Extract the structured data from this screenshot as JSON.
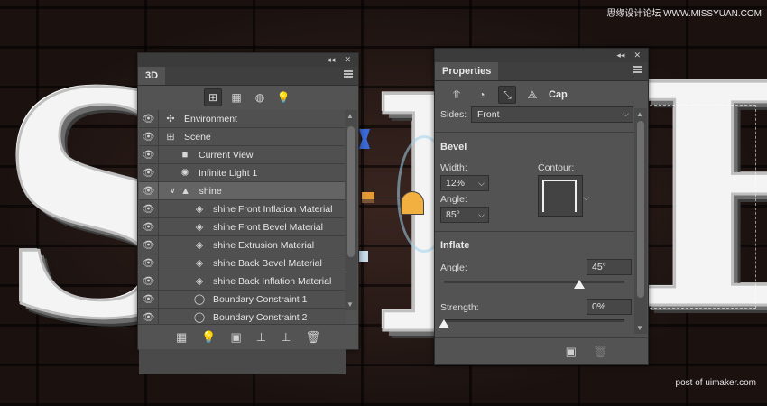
{
  "canvas": {
    "letters": [
      "S",
      "I",
      "E"
    ],
    "watermark_top": "思缘设计论坛 WWW.MISSYUAN.COM",
    "watermark_bottom": "post of uimaker.com"
  },
  "panel3d": {
    "tab": "3D",
    "collapse_glyph": "◂◂",
    "close_glyph": "✕",
    "toolbar": [
      {
        "name": "whole-scene-icon",
        "glyph": "⊞",
        "active": true
      },
      {
        "name": "meshes-icon",
        "glyph": "▦",
        "active": false
      },
      {
        "name": "materials-icon",
        "glyph": "◍",
        "active": false
      },
      {
        "name": "lights-icon",
        "glyph": "💡",
        "active": false
      }
    ],
    "rows": [
      {
        "label": "Environment",
        "icon": "✣",
        "indent": 0,
        "eye": true,
        "twisty": ""
      },
      {
        "label": "Scene",
        "icon": "⊞",
        "indent": 0,
        "eye": true,
        "twisty": ""
      },
      {
        "label": "Current View",
        "icon": "■",
        "indent": 1,
        "eye": true,
        "twisty": ""
      },
      {
        "label": "Infinite Light 1",
        "icon": "✺",
        "indent": 1,
        "eye": true,
        "twisty": ""
      },
      {
        "label": "shine",
        "icon": "▲",
        "indent": 1,
        "eye": true,
        "twisty": "∨",
        "selected": true
      },
      {
        "label": "shine Front Inflation Material",
        "icon": "◈",
        "indent": 2,
        "eye": true,
        "twisty": ""
      },
      {
        "label": "shine Front Bevel Material",
        "icon": "◈",
        "indent": 2,
        "eye": true,
        "twisty": ""
      },
      {
        "label": "shine Extrusion Material",
        "icon": "◈",
        "indent": 2,
        "eye": true,
        "twisty": ""
      },
      {
        "label": "shine Back Bevel Material",
        "icon": "◈",
        "indent": 2,
        "eye": true,
        "twisty": ""
      },
      {
        "label": "shine Back Inflation Material",
        "icon": "◈",
        "indent": 2,
        "eye": true,
        "twisty": ""
      },
      {
        "label": "Boundary Constraint 1",
        "icon": "◯",
        "indent": 2,
        "eye": true,
        "twisty": ""
      },
      {
        "label": "Boundary Constraint 2",
        "icon": "◯",
        "indent": 2,
        "eye": true,
        "twisty": ""
      }
    ],
    "bottom_icons": [
      "▦",
      "💡",
      "▣",
      "⊥",
      "⊥",
      "🗑"
    ]
  },
  "properties": {
    "tab": "Properties",
    "collapse_glyph": "◂◂",
    "close_glyph": "✕",
    "toolbar_label": "Cap",
    "sides_label": "Sides:",
    "sides_value": "Front",
    "bevel_heading": "Bevel",
    "width_label": "Width:",
    "width_value": "12%",
    "contour_label": "Contour:",
    "angle_label": "Angle:",
    "angle_value": "85°",
    "inflate_heading": "Inflate",
    "inflate_angle_label": "Angle:",
    "inflate_angle_value": "45°",
    "inflate_angle_fraction": 0.75,
    "strength_label": "Strength:",
    "strength_value": "0%",
    "strength_fraction": 0.0
  }
}
